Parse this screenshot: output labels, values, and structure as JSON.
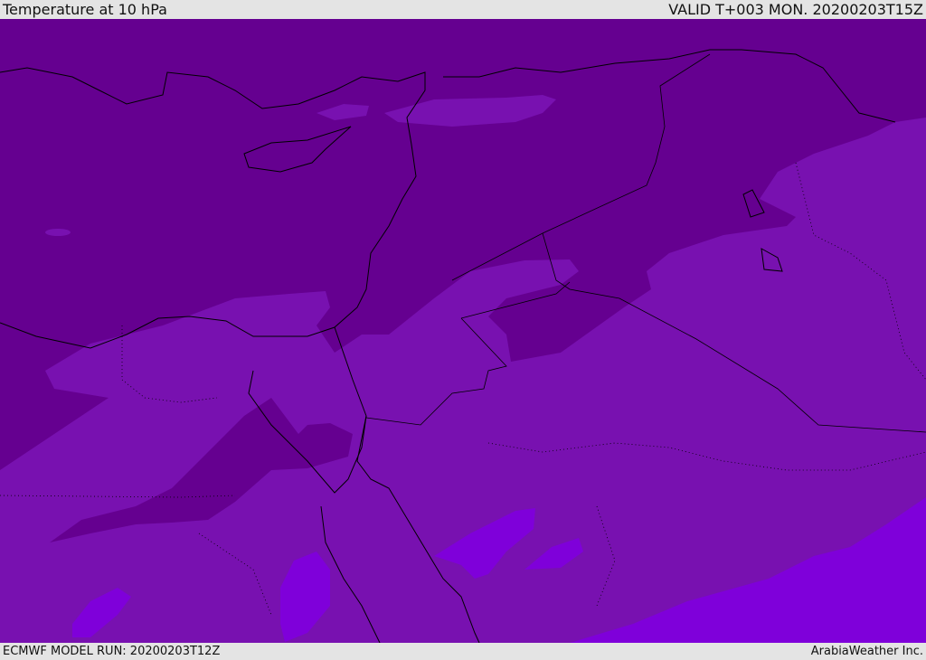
{
  "header": {
    "title": "Temperature at 10 hPa",
    "valid_time": "VALID T+003 MON. 20200203T15Z"
  },
  "footer": {
    "model_run": "ECMWF MODEL RUN: 20200203T12Z",
    "credit": "ArabiaWeather Inc."
  },
  "colors": {
    "dark_band": "#650090",
    "mid_band": "#7811b0",
    "warm_band": "#7f00da",
    "coast": "#000000"
  }
}
